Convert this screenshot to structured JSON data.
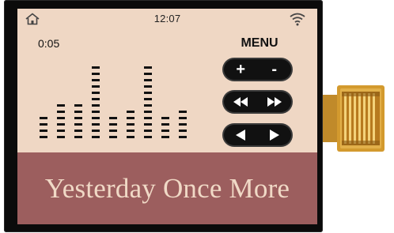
{
  "status_bar": {
    "home_icon": "home-icon",
    "time": "12:07",
    "wifi_icon": "wifi-icon"
  },
  "player": {
    "elapsed": "0:05",
    "equalizer_levels": [
      4,
      6,
      6,
      12,
      4,
      5,
      12,
      4,
      5
    ],
    "equalizer_max": 12
  },
  "menu": {
    "label": "MENU",
    "volume_up": "+",
    "volume_down": "-",
    "rewind_icon": "rewind-icon",
    "fast_forward_icon": "fast-forward-icon",
    "previous_icon": "previous-icon",
    "next_icon": "next-icon"
  },
  "song": {
    "title": "Yesterday Once More"
  },
  "colors": {
    "screen_bg": "#efd7c4",
    "title_band": "#9c5e5e",
    "title_text": "#f0d9c6",
    "button_bg": "#111111"
  }
}
